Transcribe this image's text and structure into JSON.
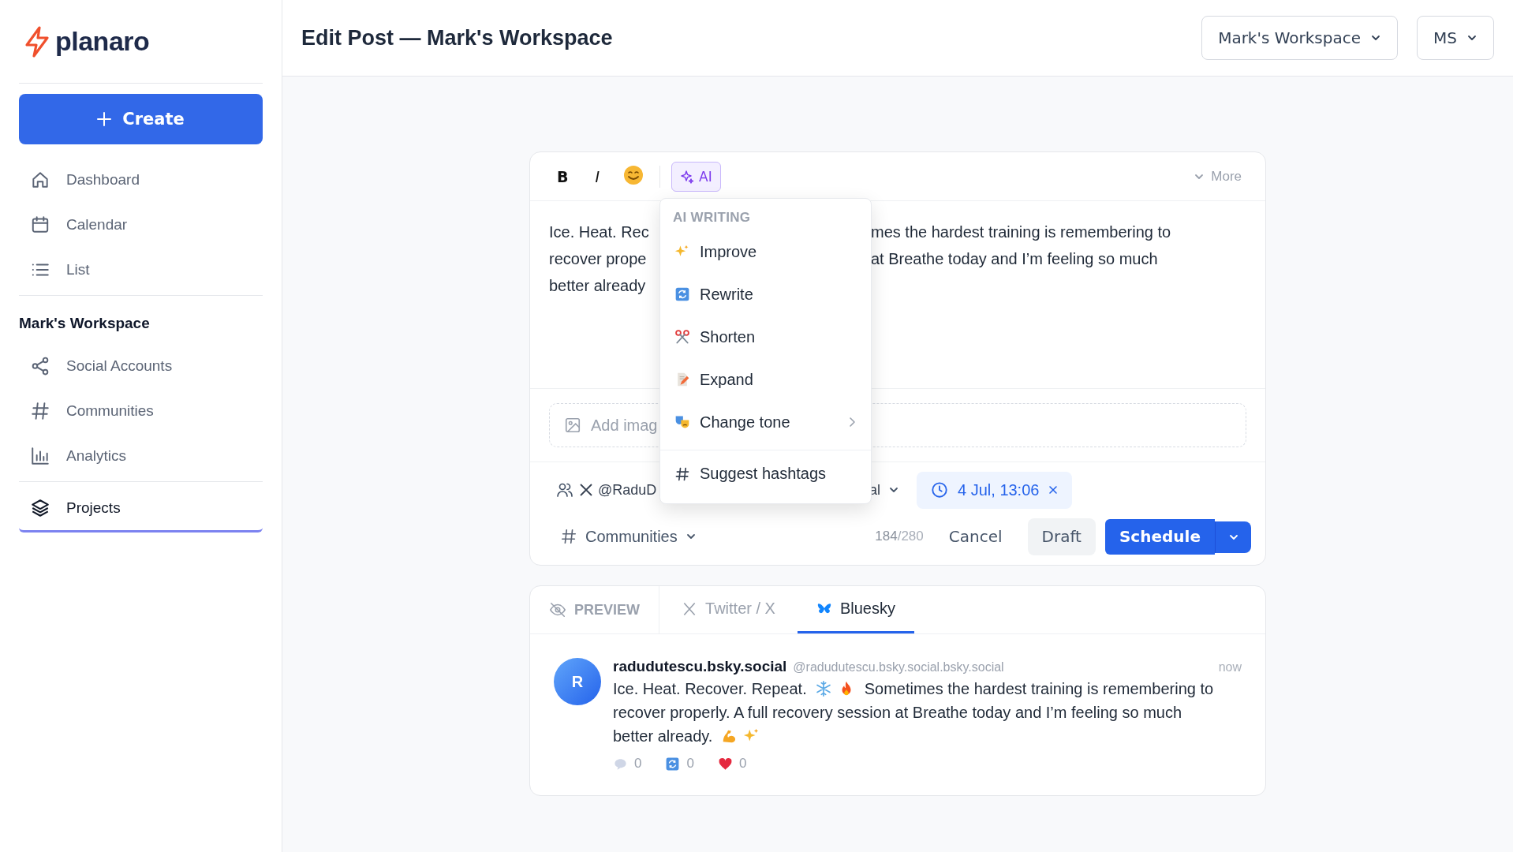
{
  "brand": {
    "name": "planaro"
  },
  "create_button": {
    "label": "Create"
  },
  "nav_groups": [
    {
      "items": [
        {
          "label": "Dashboard",
          "kind": "home",
          "selected": false
        },
        {
          "label": "Calendar",
          "kind": "calendar",
          "selected": false
        },
        {
          "label": "List",
          "kind": "list",
          "selected": false
        }
      ]
    },
    {
      "title": "Mark's Workspace",
      "items": [
        {
          "label": "Social Accounts",
          "kind": "share",
          "selected": false
        },
        {
          "label": "Communities",
          "kind": "hash",
          "selected": false
        },
        {
          "label": "Analytics",
          "kind": "chart",
          "selected": false
        }
      ]
    },
    {
      "items": [
        {
          "label": "Projects",
          "kind": "layers",
          "selected": true
        }
      ]
    }
  ],
  "header": {
    "title": "Edit Post — Mark's Workspace",
    "workspace_menu": "Mark's Workspace",
    "user_menu": "MS"
  },
  "editor": {
    "toolbar": {
      "bold": "B",
      "italic": "I",
      "ai": "AI",
      "ai_expanded": true,
      "more": "More"
    },
    "lines": [
      {
        "left": "Ice. Heat. Rec",
        "right": "mes the hardest training is remembering to"
      },
      {
        "left": "recover prope",
        "right": "at Breathe today and I’m feeling so much"
      },
      {
        "left": "better already"
      }
    ],
    "media_placeholder": "Add imag",
    "account_handle": "@RaduD",
    "account_selector": "al",
    "schedule_time": "4 Jul, 13:06",
    "communities": "Communities",
    "char_count": "184",
    "char_limit": "/280",
    "cancel": "Cancel",
    "draft": "Draft",
    "schedule": "Schedule"
  },
  "ai_menu": {
    "heading": "AI WRITING",
    "items": [
      {
        "label": "Improve",
        "kind": "improve",
        "submenu": false,
        "separated": false
      },
      {
        "label": "Rewrite",
        "kind": "rewrite",
        "submenu": false,
        "separated": false
      },
      {
        "label": "Shorten",
        "kind": "shorten",
        "submenu": false,
        "separated": false
      },
      {
        "label": "Expand",
        "kind": "expand",
        "submenu": false,
        "separated": false
      },
      {
        "label": "Change tone",
        "kind": "tone",
        "submenu": true,
        "separated": false
      },
      {
        "label": "Suggest hashtags",
        "kind": "hashtags",
        "submenu": false,
        "separated": true
      }
    ]
  },
  "preview": {
    "label": "PREVIEW",
    "tabs": [
      {
        "label": "Twitter / X",
        "kind": "x",
        "selected": false
      },
      {
        "label": "Bluesky",
        "kind": "bluesky",
        "selected": true
      }
    ],
    "post": {
      "avatar": "R",
      "name": "radudutescu.bsky.social",
      "handle": "@radudutescu.bsky.social.bsky.social",
      "time": "now",
      "lines": [
        [
          {
            "kind": "text",
            "value": "Ice. Heat. Recover. Repeat."
          },
          {
            "kind": "snowflake"
          },
          {
            "kind": "fire"
          },
          {
            "kind": "text",
            "value": "Sometimes the hardest training is remembering to"
          }
        ],
        [
          {
            "kind": "text",
            "value": "recover properly. A full recovery session at Breathe today and I’m feeling so much"
          }
        ],
        [
          {
            "kind": "text",
            "value": "better already."
          },
          {
            "kind": "muscle"
          },
          {
            "kind": "sparkles"
          }
        ]
      ],
      "stats": [
        {
          "kind": "comment",
          "count": "0"
        },
        {
          "kind": "repost",
          "count": "0"
        },
        {
          "kind": "like",
          "count": "0"
        }
      ]
    }
  }
}
